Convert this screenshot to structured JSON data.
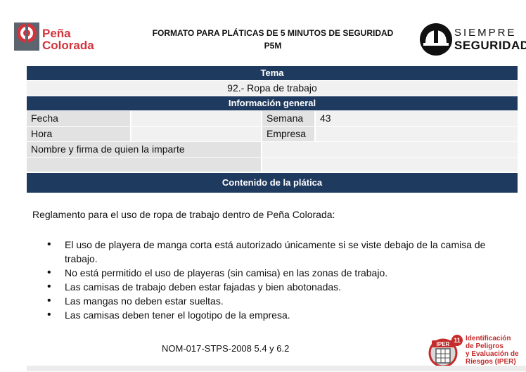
{
  "header": {
    "brand_line1": "Peña",
    "brand_line2": "Colorada",
    "title_line1": "FORMATO PARA PLÁTICAS DE 5 MINUTOS DE SEGURIDAD",
    "title_line2": "P5M",
    "right_logo_line1": "SIEMPRE",
    "right_logo_line2": "SEGURIDAD"
  },
  "tema": {
    "heading": "Tema",
    "value": "92.- Ropa de trabajo"
  },
  "info": {
    "heading": "Información general",
    "fecha_label": "Fecha",
    "fecha_value": "",
    "semana_label": "Semana",
    "semana_value": "43",
    "hora_label": "Hora",
    "hora_value": "",
    "empresa_label": "Empresa",
    "empresa_value": "",
    "nombre_label": "Nombre y firma de quien la imparte",
    "nombre_value": ""
  },
  "contenido": {
    "heading": "Contenido de la plática",
    "intro": "Reglamento para el uso de ropa de trabajo dentro de Peña Colorada:",
    "bullets": [
      "El uso de playera de manga corta está autorizado únicamente si se viste debajo de la camisa de trabajo.",
      "No está permitido el uso de playeras (sin camisa) en las zonas de trabajo.",
      "Las camisas de trabajo deben estar fajadas y bien abotonadas.",
      "Las mangas no deben estar sueltas.",
      "Las camisas deben tener el logotipo de la empresa."
    ],
    "norma": "NOM-017-STPS-2008 5.4 y 6.2"
  },
  "iper": {
    "badge_label": "IPER",
    "badge_number": "11",
    "caption_line1": "Identificación",
    "caption_line2": "de Peligros",
    "caption_line3": "y Evaluación de",
    "caption_line4": "Riesgos (IPER)"
  },
  "colors": {
    "navy_bar": "#1f3a5f",
    "brand_red": "#d2343b",
    "grey_cell": "#e2e2e2"
  },
  "icons": [
    "pena-colorada-logo-icon",
    "hardhat-icon",
    "iper-badge-icon"
  ]
}
